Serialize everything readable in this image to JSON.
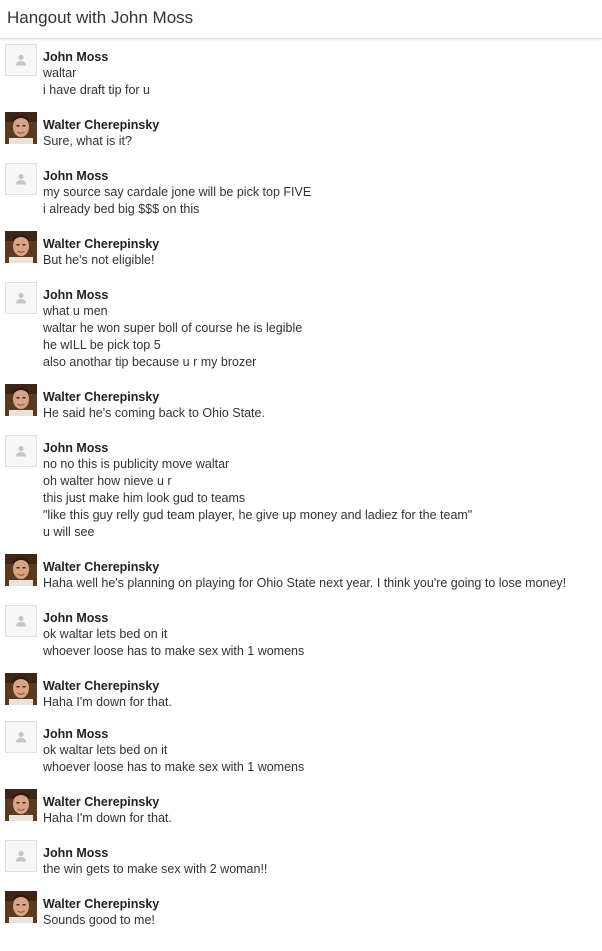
{
  "header": {
    "title": "Hangout with John Moss"
  },
  "messages": [
    {
      "sender": "John Moss",
      "avatar": "placeholder-person-icon",
      "lines": [
        "waltar",
        "i have draft tip for u"
      ]
    },
    {
      "sender": "Walter Cherepinsky",
      "avatar": "profile-photo",
      "lines": [
        "Sure, what is it?"
      ]
    },
    {
      "sender": "John Moss",
      "avatar": "placeholder-person-icon",
      "lines": [
        "my source say cardale jone will be pick top FIVE",
        "i already bed big $$$ on this"
      ]
    },
    {
      "sender": "Walter Cherepinsky",
      "avatar": "profile-photo",
      "lines": [
        "But he's not eligible!"
      ]
    },
    {
      "sender": "John Moss",
      "avatar": "placeholder-person-icon",
      "lines": [
        "what u men",
        "waltar he won super boll of course he is legible",
        "he wILL be pick top 5",
        "also anothar tip because u r my brozer"
      ]
    },
    {
      "sender": "Walter Cherepinsky",
      "avatar": "profile-photo",
      "lines": [
        "He said he's coming back to Ohio State."
      ]
    },
    {
      "sender": "John Moss",
      "avatar": "placeholder-person-icon",
      "lines": [
        "no no this is publicity move waltar",
        "oh walter how nieve u r",
        "this just make him look gud to teams",
        "\"like this guy relly gud team player, he give up money and ladiez for the team\"",
        "u will see"
      ]
    },
    {
      "sender": "Walter Cherepinsky",
      "avatar": "profile-photo",
      "lines": [
        "Haha well he's planning on playing for Ohio State next year. I think you're going to lose money!"
      ]
    },
    {
      "sender": "John Moss",
      "avatar": "placeholder-person-icon",
      "lines": [
        "ok waltar lets bed on it",
        "whoever loose has to make sex with 1 womens"
      ]
    },
    {
      "sender": "Walter Cherepinsky",
      "avatar": "profile-photo",
      "lines": [
        "Haha I'm down for that."
      ]
    },
    {
      "sender": "John Moss",
      "avatar": "placeholder-person-icon",
      "lines": [
        "ok waltar lets bed on it",
        "whoever loose has to make sex with 1 womens"
      ]
    },
    {
      "sender": "Walter Cherepinsky",
      "avatar": "profile-photo",
      "lines": [
        "Haha I'm down for that."
      ]
    },
    {
      "sender": "John Moss",
      "avatar": "placeholder-person-icon",
      "lines": [
        "the win gets to make sex with 2 woman!!"
      ]
    },
    {
      "sender": "Walter Cherepinsky",
      "avatar": "profile-photo",
      "lines": [
        "Sounds good to me!"
      ]
    }
  ]
}
